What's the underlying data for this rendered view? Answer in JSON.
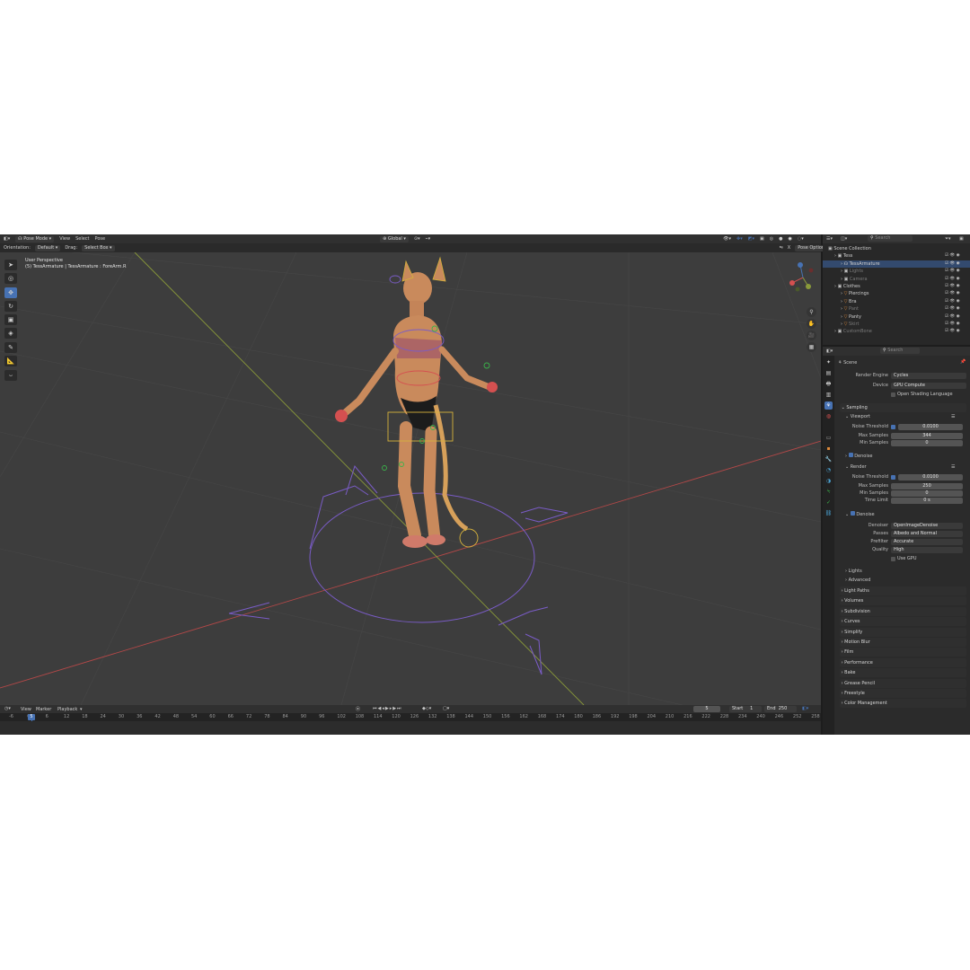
{
  "header": {
    "mode": "Pose Mode",
    "menus": [
      "View",
      "Select",
      "Pose"
    ],
    "transform_orientation": "Global",
    "options_label": "Pose Options"
  },
  "subheader": {
    "orientation_label": "Orientation:",
    "orientation_value": "Default",
    "drag_label": "Drag:",
    "drag_value": "Select Box"
  },
  "viewport": {
    "view_name": "User Perspective",
    "active": "(5) TessArmature | TessArmature : ForeArm.R",
    "gizmo_axes": [
      "X",
      "Y",
      "Z"
    ]
  },
  "outliner": {
    "search_placeholder": "Search",
    "rows": [
      {
        "label": "Scene Collection",
        "indent": 0,
        "icon": "collection"
      },
      {
        "label": "Tess",
        "indent": 1,
        "icon": "collection"
      },
      {
        "label": "TessArmature",
        "indent": 2,
        "icon": "armature",
        "selected": true
      },
      {
        "label": "Lights",
        "indent": 2,
        "icon": "collection",
        "muted": true
      },
      {
        "label": "Camera",
        "indent": 2,
        "icon": "collection",
        "muted": true
      },
      {
        "label": "Clothes",
        "indent": 1,
        "icon": "collection"
      },
      {
        "label": "Piercings",
        "indent": 2,
        "icon": "mesh"
      },
      {
        "label": "Bra",
        "indent": 2,
        "icon": "mesh"
      },
      {
        "label": "Pant",
        "indent": 2,
        "icon": "mesh",
        "muted": true
      },
      {
        "label": "Panty",
        "indent": 2,
        "icon": "mesh"
      },
      {
        "label": "Skirt",
        "indent": 2,
        "icon": "mesh",
        "muted": true
      },
      {
        "label": "CustomBone",
        "indent": 1,
        "icon": "collection",
        "muted": true
      }
    ]
  },
  "properties": {
    "search_placeholder": "Search",
    "context": "Scene",
    "render_engine_label": "Render Engine",
    "render_engine": "Cycles",
    "device_label": "Device",
    "device": "GPU Compute",
    "osl_label": "Open Shading Language",
    "sampling": "Sampling",
    "viewport_section": "Viewport",
    "vp_noise_label": "Noise Threshold",
    "vp_noise": "0.0100",
    "vp_max_label": "Max Samples",
    "vp_max": "344",
    "vp_min_label": "Min Samples",
    "vp_min": "0",
    "vp_denoise": "Denoise",
    "render_section": "Render",
    "r_noise_label": "Noise Threshold",
    "r_noise": "0.0100",
    "r_max_label": "Max Samples",
    "r_max": "250",
    "r_min_label": "Min Samples",
    "r_min": "0",
    "r_time_label": "Time Limit",
    "r_time": "0 s",
    "r_denoise": "Denoise",
    "denoiser_label": "Denoiser",
    "denoiser": "OpenImageDenoise",
    "passes_label": "Passes",
    "passes": "Albedo and Normal",
    "prefilter_label": "Prefilter",
    "prefilter": "Accurate",
    "quality_label": "Quality",
    "quality": "High",
    "use_gpu_label": "Use GPU",
    "sub_panels": [
      "Lights",
      "Advanced"
    ],
    "panels": [
      "Light Paths",
      "Volumes",
      "Subdivision",
      "Curves",
      "Simplify",
      "Motion Blur",
      "Film",
      "Performance",
      "Bake",
      "Grease Pencil",
      "Freestyle",
      "Color Management"
    ]
  },
  "timeline": {
    "menus": [
      "View",
      "Marker",
      "Playback"
    ],
    "current_frame": "5",
    "start_label": "Start",
    "start": "1",
    "end_label": "End",
    "end": "250",
    "ruler": [
      "-6",
      "0",
      "6",
      "12",
      "18",
      "24",
      "30",
      "36",
      "42",
      "48",
      "54",
      "60",
      "66",
      "72",
      "78",
      "84",
      "90",
      "96",
      "102",
      "108",
      "114",
      "120",
      "126",
      "132",
      "138",
      "144",
      "150",
      "156",
      "162",
      "168",
      "174",
      "180",
      "186",
      "192",
      "198",
      "204",
      "210",
      "216",
      "222",
      "228",
      "234",
      "240",
      "246",
      "252",
      "258"
    ],
    "playhead": "5"
  },
  "colors": {
    "accent": "#4772b3",
    "viewport_bg": "#3d3d3d",
    "x_axis": "#b34848",
    "y_axis": "#8a9a3a",
    "bone_purple": "#7a5cc7"
  }
}
